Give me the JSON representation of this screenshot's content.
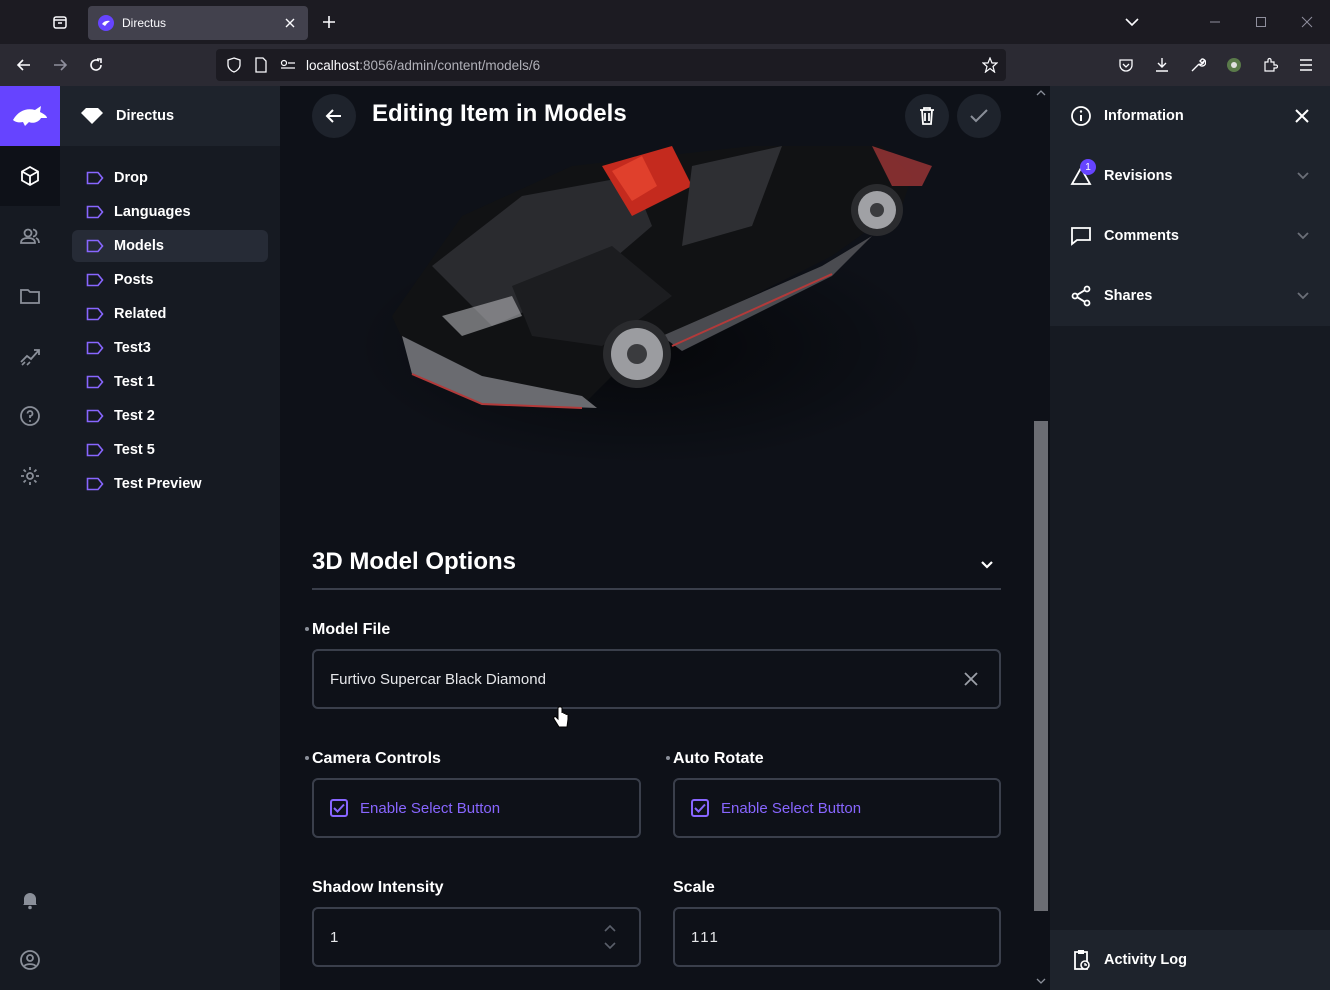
{
  "browser": {
    "tab_title": "Directus",
    "url_host": "localhost",
    "url_port_path": ":8056/admin/content/models/6"
  },
  "app": {
    "project_name": "Directus",
    "collections": [
      "Drop",
      "Languages",
      "Models",
      "Posts",
      "Related",
      "Test3",
      "Test 1",
      "Test 2",
      "Test 5",
      "Test Preview"
    ],
    "active_collection": "Models"
  },
  "header": {
    "title": "Editing Item in Models"
  },
  "form": {
    "group_title": "3D Model Options",
    "model_file_label": "Model File",
    "model_file_value": "Furtivo Supercar Black Diamond",
    "camera_controls_label": "Camera Controls",
    "camera_controls_checkbox": "Enable Select Button",
    "auto_rotate_label": "Auto Rotate",
    "auto_rotate_checkbox": "Enable Select Button",
    "shadow_intensity_label": "Shadow Intensity",
    "shadow_intensity_value": "1",
    "scale_label": "Scale",
    "scale_value": "111"
  },
  "sidebar": {
    "information": "Information",
    "revisions": "Revisions",
    "revisions_badge": "1",
    "comments": "Comments",
    "shares": "Shares",
    "activity_log": "Activity Log"
  },
  "colors": {
    "accent": "#6644ff",
    "checkbox": "#8866ff"
  }
}
